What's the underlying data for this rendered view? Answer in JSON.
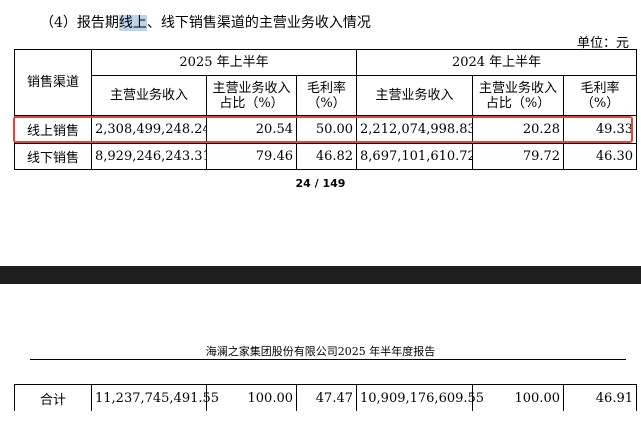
{
  "section": {
    "prefix": "（4）报告期",
    "highlighted": "线上",
    "suffix": "、线下销售渠道的主营业务收入情况"
  },
  "unit_label": "单位：元",
  "table": {
    "channel_header": "销售渠道",
    "period_2025": "2025 年上半年",
    "period_2024": "2024 年上半年",
    "col_revenue": "主营业务收入",
    "col_share_line1": "主营业务收入",
    "col_share_line2": "占比（%）",
    "col_margin_line1": "毛利率",
    "col_margin_line2": "（%）",
    "rows": [
      {
        "channel": "线上销售",
        "rev_2025": "2,308,499,248.24",
        "share_2025": "20.54",
        "margin_2025": "50.00",
        "rev_2024": "2,212,074,998.83",
        "share_2024": "20.28",
        "margin_2024": "49.33"
      },
      {
        "channel": "线下销售",
        "rev_2025": "8,929,246,243.31",
        "share_2025": "79.46",
        "margin_2025": "46.82",
        "rev_2024": "8,697,101,610.72",
        "share_2024": "79.72",
        "margin_2024": "46.30"
      }
    ],
    "total": {
      "channel": "合计",
      "rev_2025": "11,237,745,491.55",
      "share_2025": "100.00",
      "margin_2025": "47.47",
      "rev_2024": "10,909,176,609.55",
      "share_2024": "100.00",
      "margin_2024": "46.91"
    }
  },
  "page_number": "24 / 149",
  "report_header": "海澜之家集团股份有限公司2025 年半年度报告",
  "colors": {
    "highlight_box": "#e8413f",
    "text_selection": "#bcd3ee",
    "page_gap": "#1e1e1e"
  }
}
